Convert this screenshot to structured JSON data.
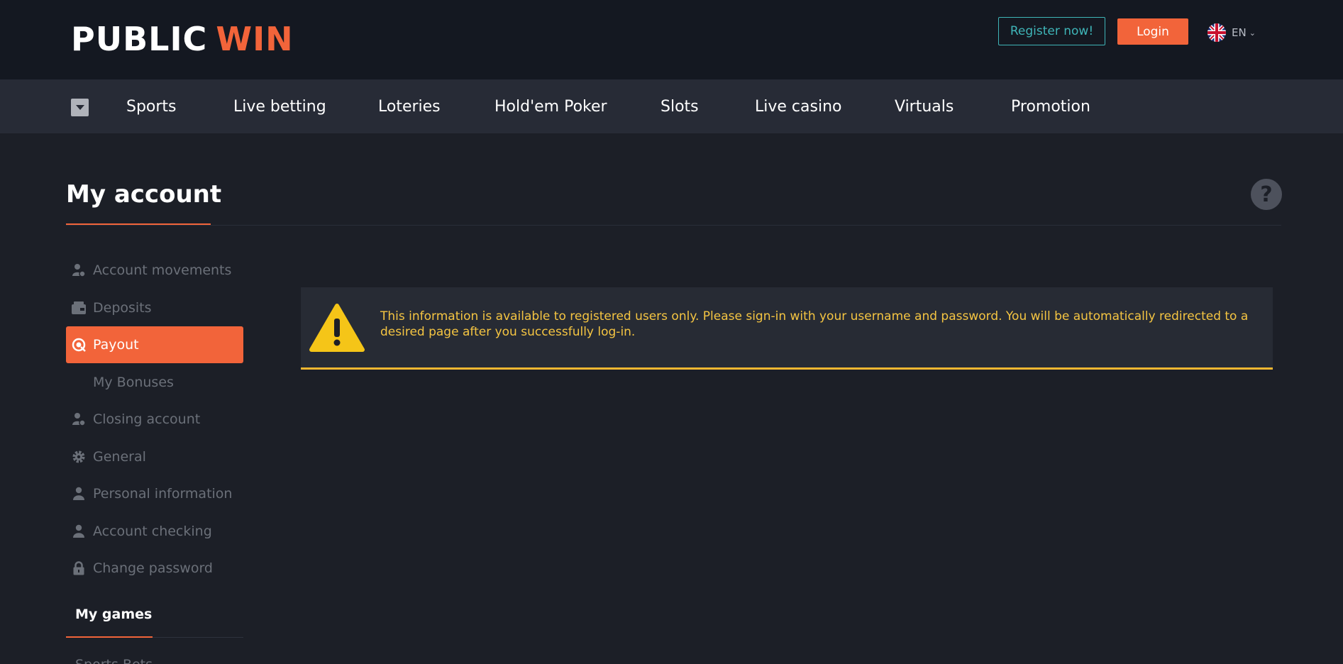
{
  "header": {
    "logo_part1": "PUBLIC",
    "logo_part2": "WIN",
    "register_label": "Register now!",
    "login_label": "Login",
    "language": "EN",
    "flag_icon": "uk-flag-icon"
  },
  "nav": {
    "toggle_icon": "caret-down-icon",
    "items": [
      "Sports",
      "Live betting",
      "Loteries",
      "Hold'em Poker",
      "Slots",
      "Live casino",
      "Virtuals",
      "Promotion"
    ]
  },
  "page": {
    "title": "My account",
    "help_icon": "question-icon",
    "help_glyph": "?"
  },
  "sidebar": {
    "items": [
      {
        "label": "Account movements",
        "icon": "user-coin-icon"
      },
      {
        "label": "Deposits",
        "icon": "wallet-icon"
      },
      {
        "label": "Payout",
        "icon": "payout-icon",
        "active": true
      },
      {
        "label": "My Bonuses",
        "icon": ""
      },
      {
        "label": "Closing account",
        "icon": "user-close-icon"
      },
      {
        "label": "General",
        "icon": "gear-icon"
      },
      {
        "label": "Personal information",
        "icon": "user-icon"
      },
      {
        "label": "Account checking",
        "icon": "user-check-icon"
      },
      {
        "label": "Change password",
        "icon": "lock-icon"
      }
    ],
    "section_title": "My games",
    "section_first_item": "Sports Bets"
  },
  "alert": {
    "icon": "warning-icon",
    "message": "This information is available to registered users only. Please sign-in with your username and password. You will be automatically redirected to a desired page after you successfully log-in."
  },
  "colors": {
    "accent": "#f2643a",
    "teal": "#3fb5b8",
    "warning": "#f5c542",
    "background": "#1c1f27"
  }
}
